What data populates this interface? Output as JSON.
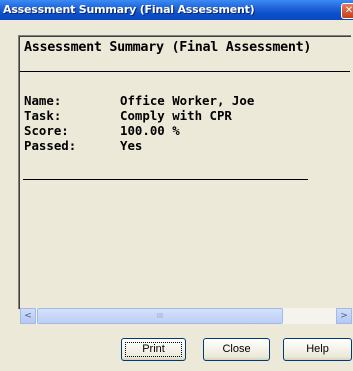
{
  "window": {
    "title": "Assessment Summary (Final Assessment)",
    "close_glyph": "✕"
  },
  "report": {
    "heading": "Assessment Summary (Final Assessment)",
    "fields": [
      {
        "label": "Name:",
        "value": "Office Worker, Joe"
      },
      {
        "label": "Task:",
        "value": "Comply with CPR"
      },
      {
        "label": "Score:",
        "value": "100.00 %"
      },
      {
        "label": "Passed:",
        "value": "Yes"
      }
    ]
  },
  "scrollbar": {
    "left_glyph": "<",
    "right_glyph": ">",
    "grip": "III"
  },
  "buttons": {
    "print": "Print",
    "close": "Close",
    "help": "Help"
  },
  "colors": {
    "titlebar": "#0a4fcb",
    "dialog_bg": "#ece9d8",
    "button_border": "#003c74"
  },
  "icons": {
    "close": "close-icon",
    "scroll_left": "chevron-left-icon",
    "scroll_right": "chevron-right-icon"
  }
}
